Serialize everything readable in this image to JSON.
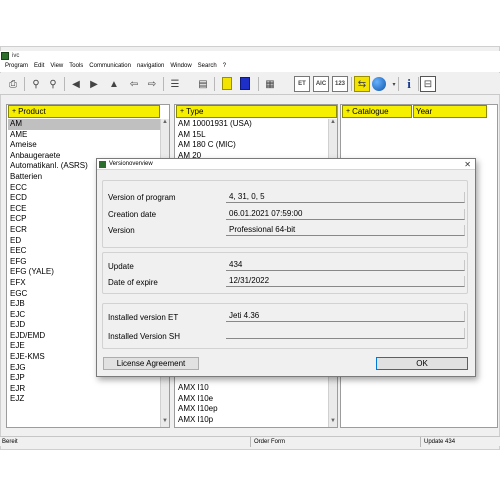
{
  "window": {
    "title": "ivc"
  },
  "menu": [
    "Program",
    "Edit",
    "View",
    "Tools",
    "Communication",
    "navigation",
    "Window",
    "Search",
    "?"
  ],
  "toolbar": {
    "icons": [
      "print-icon",
      "zoom-in-icon",
      "zoom-out-icon",
      "first-icon",
      "prev-icon",
      "next-icon",
      "up-icon",
      "back-arrow-icon",
      "forward-arrow-icon",
      "structure-icon",
      "document-icon",
      "yellow-square-icon",
      "blue-square-icon",
      "et-icon",
      "aic-icon",
      "count-icon",
      "layout-icon",
      "globe-icon",
      "info-icon",
      "exit-icon"
    ],
    "et_label": "ET",
    "aic_label": "AIC",
    "count_label": "123"
  },
  "product": {
    "header": "Product",
    "items": [
      "AM",
      "AME",
      "Ameise",
      "Anbaugeraete",
      "Automatikanl. (ASRS)",
      "Batterien",
      "ECC",
      "ECD",
      "ECE",
      "ECP",
      "ECR",
      "ED",
      "EEC",
      "EFG",
      "EFG (YALE)",
      "EFX",
      "EGC",
      "EJB",
      "EJC",
      "EJD",
      "EJD/EMD",
      "EJE",
      "EJE-KMS",
      "EJG",
      "EJP",
      "EJR",
      "EJZ"
    ],
    "selected": 0
  },
  "type": {
    "header": "Type",
    "top_items": [
      "AM 10001931 (USA)",
      "AM 15L",
      "AM 180 C (MIC)",
      "AM 20"
    ],
    "bottom_items": [
      "AMX I10",
      "AMX I10e",
      "AMX I10ep",
      "AMX I10p"
    ]
  },
  "catalogue": {
    "header": "Catalogue",
    "year_header": "Year"
  },
  "dialog": {
    "title": "Versionoverview",
    "rows1": [
      {
        "label": "Version of program",
        "value": "4, 31, 0, 5"
      },
      {
        "label": "Creation date",
        "value": "06.01.2021 07:59:00"
      },
      {
        "label": "Version",
        "value": "Professional 64-bit"
      }
    ],
    "rows2": [
      {
        "label": "Update",
        "value": "434"
      },
      {
        "label": "Date of expire",
        "value": "12/31/2022"
      }
    ],
    "rows3": [
      {
        "label": "Installed version ET",
        "value": "Jeti 4.36"
      },
      {
        "label": "Installed Version SH",
        "value": ""
      }
    ],
    "license_button": "License Agreement",
    "ok_button": "OK",
    "close_glyph": "✕"
  },
  "status": {
    "ready": "Bereit",
    "order": "Order Form",
    "update": "Update 434"
  }
}
